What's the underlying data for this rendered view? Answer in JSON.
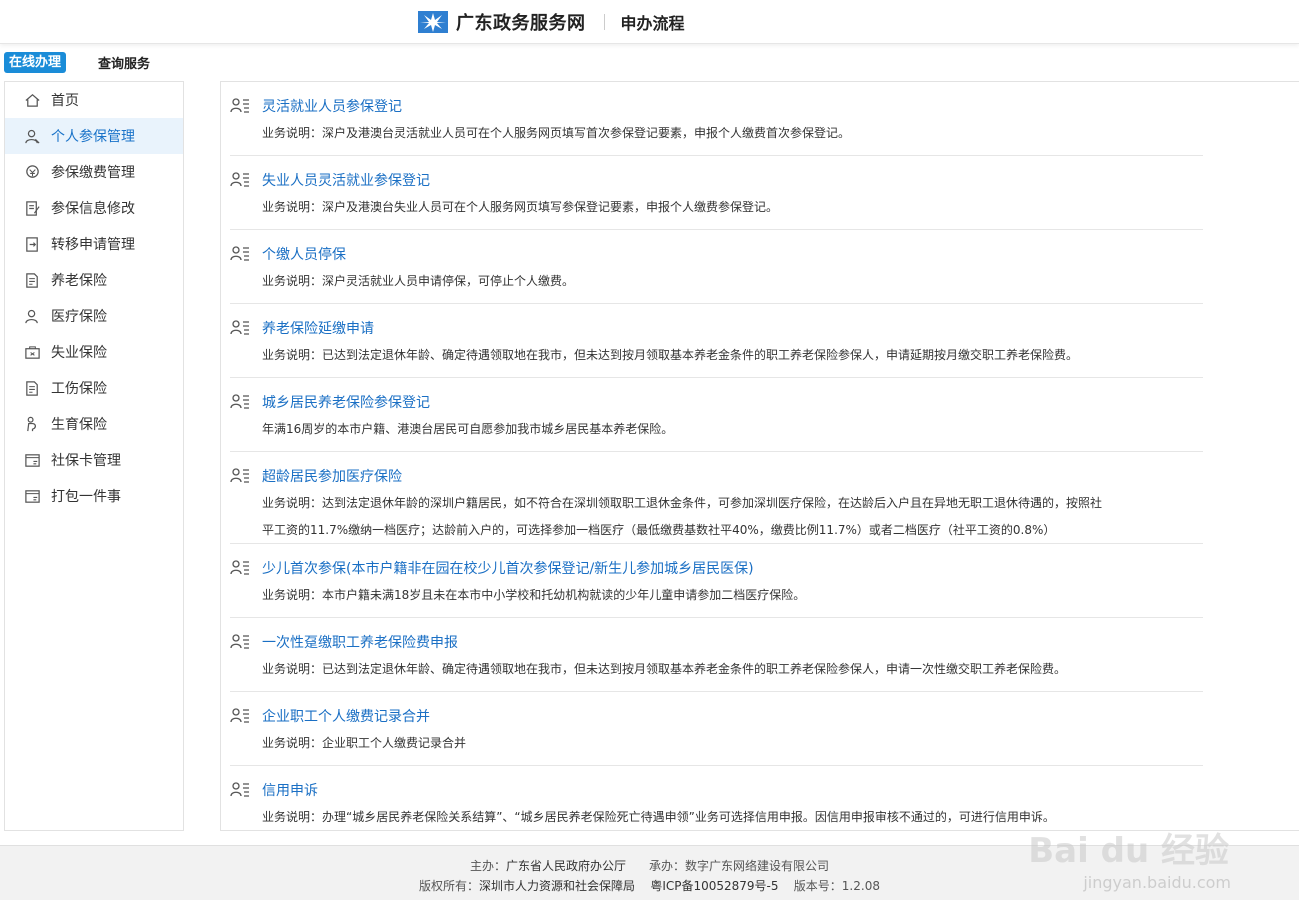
{
  "header": {
    "site_name": "广东政务服务网",
    "subtitle": "申办流程"
  },
  "tabs": [
    {
      "label": "在线办理",
      "active": true
    },
    {
      "label": "查询服务",
      "active": false
    }
  ],
  "sidebar": {
    "items": [
      {
        "label": "首页",
        "icon": "home-icon"
      },
      {
        "label": "个人参保管理",
        "icon": "person-icon",
        "active": true
      },
      {
        "label": "参保缴费管理",
        "icon": "payment-icon"
      },
      {
        "label": "参保信息修改",
        "icon": "edit-icon"
      },
      {
        "label": "转移申请管理",
        "icon": "transfer-icon"
      },
      {
        "label": "养老保险",
        "icon": "document-icon"
      },
      {
        "label": "医疗保险",
        "icon": "person-icon"
      },
      {
        "label": "失业保险",
        "icon": "briefcase-icon"
      },
      {
        "label": "工伤保险",
        "icon": "document-icon"
      },
      {
        "label": "生育保险",
        "icon": "mother-icon"
      },
      {
        "label": "社保卡管理",
        "icon": "card-icon"
      },
      {
        "label": "打包一件事",
        "icon": "card-icon"
      }
    ]
  },
  "services": [
    {
      "title": "灵活就业人员参保登记",
      "desc": "业务说明：深户及港澳台灵活就业人员可在个人服务网页填写首次参保登记要素，申报个人缴费首次参保登记。"
    },
    {
      "title": "失业人员灵活就业参保登记",
      "desc": "业务说明：深户及港澳台失业人员可在个人服务网页填写参保登记要素，申报个人缴费参保登记。"
    },
    {
      "title": "个缴人员停保",
      "desc": "业务说明：深户灵活就业人员申请停保，可停止个人缴费。"
    },
    {
      "title": "养老保险延缴申请",
      "desc": "业务说明：已达到法定退休年龄、确定待遇领取地在我市，但未达到按月领取基本养老金条件的职工养老保险参保人，申请延期按月缴交职工养老保险费。"
    },
    {
      "title": "城乡居民养老保险参保登记",
      "desc": "年满16周岁的本市户籍、港澳台居民可自愿参加我市城乡居民基本养老保险。"
    },
    {
      "title": "超龄居民参加医疗保险",
      "desc": "业务说明：达到法定退休年龄的深圳户籍居民，如不符合在深圳领取职工退休金条件，可参加深圳医疗保险，在达龄后入户且在异地无职工退休待遇的，按照社",
      "desc2": "平工资的11.7%缴纳一档医疗；达龄前入户的，可选择参加一档医疗（最低缴费基数社平40%，缴费比例11.7%）或者二档医疗（社平工资的0.8%）"
    },
    {
      "title": "少儿首次参保(本市户籍非在园在校少儿首次参保登记/新生儿参加城乡居民医保)",
      "desc": "业务说明：本市户籍未满18岁且未在本市中小学校和托幼机构就读的少年儿童申请参加二档医疗保险。"
    },
    {
      "title": "一次性趸缴职工养老保险费申报",
      "desc": "业务说明：已达到法定退休年龄、确定待遇领取地在我市，但未达到按月领取基本养老金条件的职工养老保险参保人，申请一次性缴交职工养老保险费。"
    },
    {
      "title": "企业职工个人缴费记录合并",
      "desc": "业务说明：企业职工个人缴费记录合并"
    },
    {
      "title": "信用申诉",
      "desc": "业务说明：办理“城乡居民养老保险关系结算”、“城乡居民养老保险死亡待遇申领”业务可选择信用申报。因信用申报审核不通过的，可进行信用申诉。"
    }
  ],
  "footer": {
    "host_label": "主办：",
    "host": "广东省人民政府办公厅",
    "org_label": "承办：",
    "org": "数字广东网络建设有限公司",
    "copyright_label": "版权所有：",
    "copyright": "深圳市人力资源和社会保障局",
    "icp": "粤ICP备10052879号-5",
    "version_label": "版本号：",
    "version": "1.2.08"
  },
  "watermark": {
    "text": "Bai du 经验",
    "url": "jingyan.baidu.com"
  },
  "colors": {
    "accent": "#1a8cd8",
    "link": "#1a6fc4",
    "active_bg": "#e9f3fc"
  }
}
